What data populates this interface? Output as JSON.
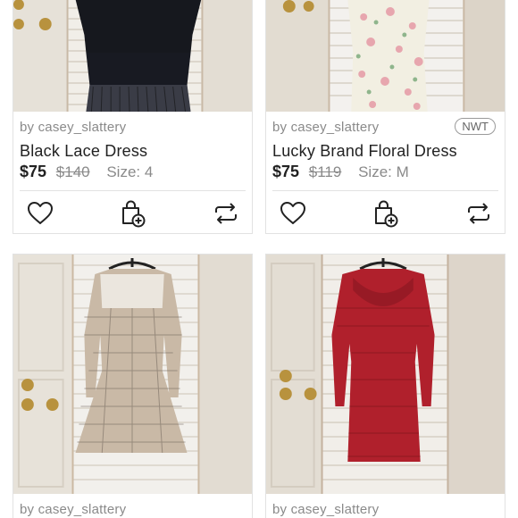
{
  "listings": [
    {
      "seller": "by casey_slattery",
      "title": "Black Lace Dress",
      "price": "$75",
      "original_price": "$140",
      "size": "Size: 4",
      "badge": "",
      "dress_color": "#16181e"
    },
    {
      "seller": "by casey_slattery",
      "title": "Lucky Brand Floral Dress",
      "price": "$75",
      "original_price": "$119",
      "size": "Size: M",
      "badge": "NWT",
      "dress_color": "#f2efe2"
    },
    {
      "seller": "by casey_slattery",
      "dress_color": "#c9b9a6"
    },
    {
      "seller": "by casey_slattery",
      "dress_color": "#b0202c"
    }
  ],
  "icons": {
    "like": "heart-icon",
    "bundle": "shopping-bag-plus-icon",
    "share": "share-repost-icon"
  }
}
